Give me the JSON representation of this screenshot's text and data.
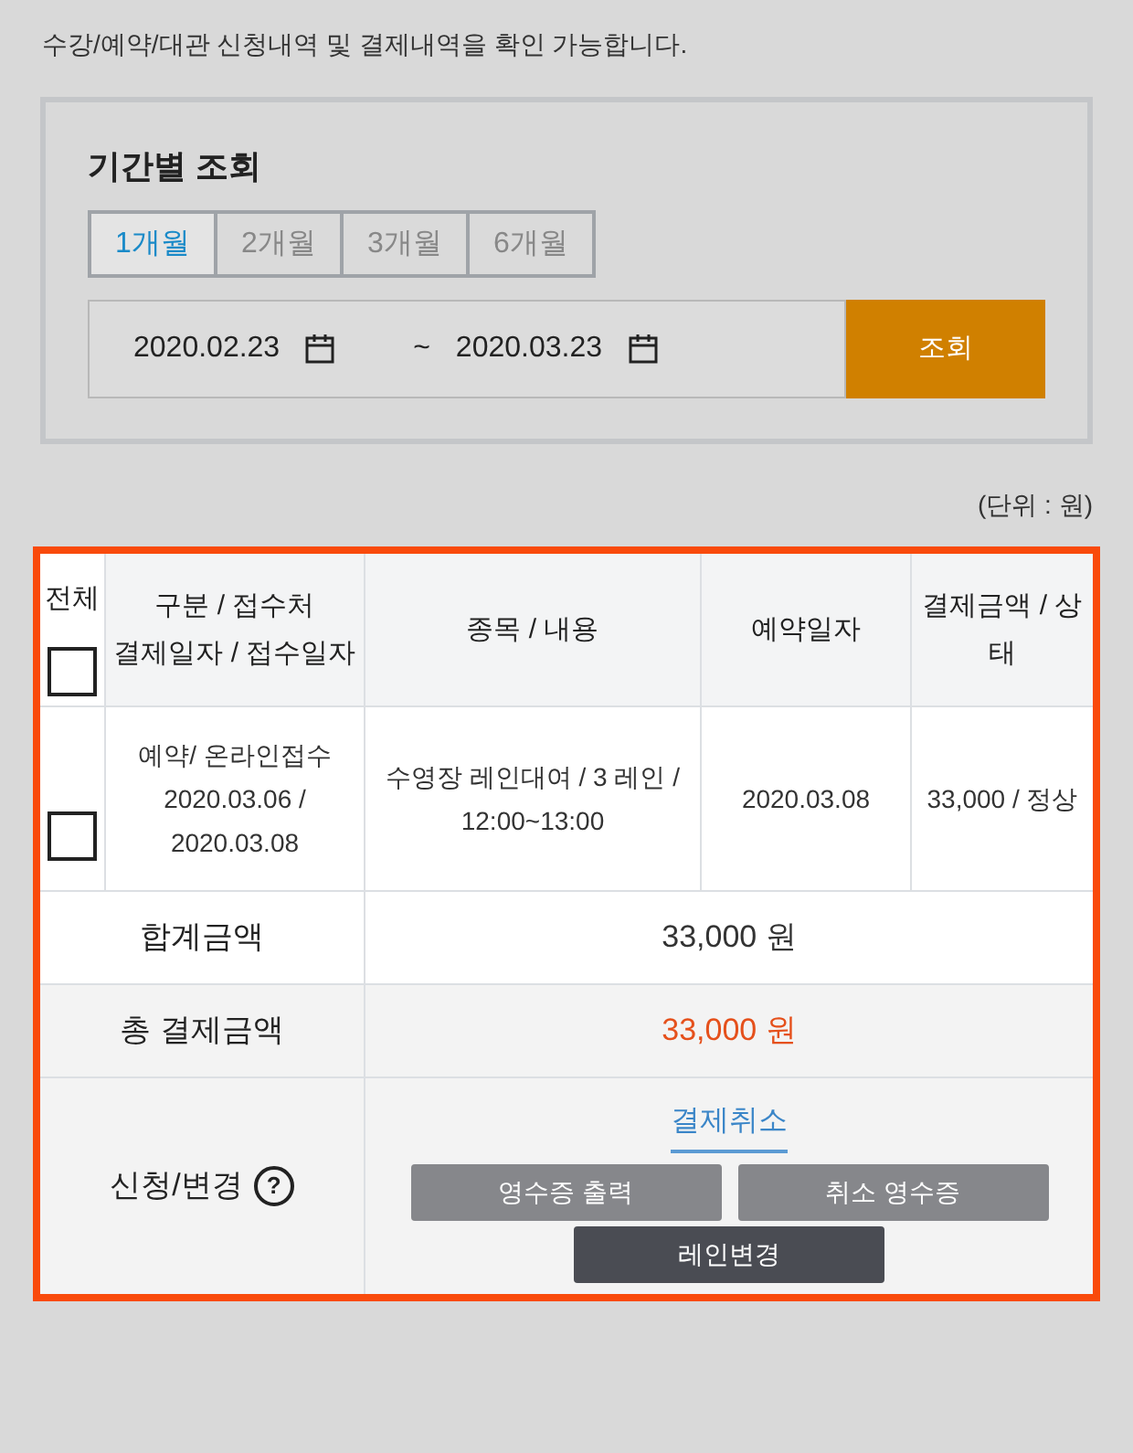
{
  "intro": "수강/예약/대관 신청내역 및 결제내역을 확인 가능합니다.",
  "search": {
    "title": "기간별 조회",
    "periods": [
      {
        "label": "1개월",
        "selected": true
      },
      {
        "label": "2개월",
        "selected": false
      },
      {
        "label": "3개월",
        "selected": false
      },
      {
        "label": "6개월",
        "selected": false
      }
    ],
    "start_date": "2020.02.23",
    "separator": "~",
    "end_date": "2020.03.23",
    "button": "조회"
  },
  "unit": "(단위 : 원)",
  "table": {
    "select_all": {
      "label": "전체",
      "checked": false
    },
    "columns": [
      "구분 / 접수처\n결제일자 / 접수일자",
      "종목 / 내용",
      "예약일자",
      "결제금액 / 상태"
    ],
    "rows": [
      {
        "checked": false,
        "cells": [
          "예약/ 온라인접수\n2020.03.06 /\n2020.03.08",
          "수영장 레인대여 / 3 레인 /\n12:00~13:00",
          "2020.03.08",
          "33,000 / 정상"
        ]
      }
    ]
  },
  "summary": [
    {
      "label": "합계금액",
      "value": "33,000 원",
      "highlight": false
    },
    {
      "label": "총 결제금액",
      "value": "33,000 원",
      "highlight": true
    }
  ],
  "actions": {
    "label": "신청/변경",
    "help": "?",
    "link": "결제취소",
    "buttons": [
      {
        "label": "영수증 출력",
        "kind": "secondary"
      },
      {
        "label": "취소 영수증",
        "kind": "secondary"
      },
      {
        "label": "레인변경",
        "kind": "primary"
      }
    ]
  }
}
